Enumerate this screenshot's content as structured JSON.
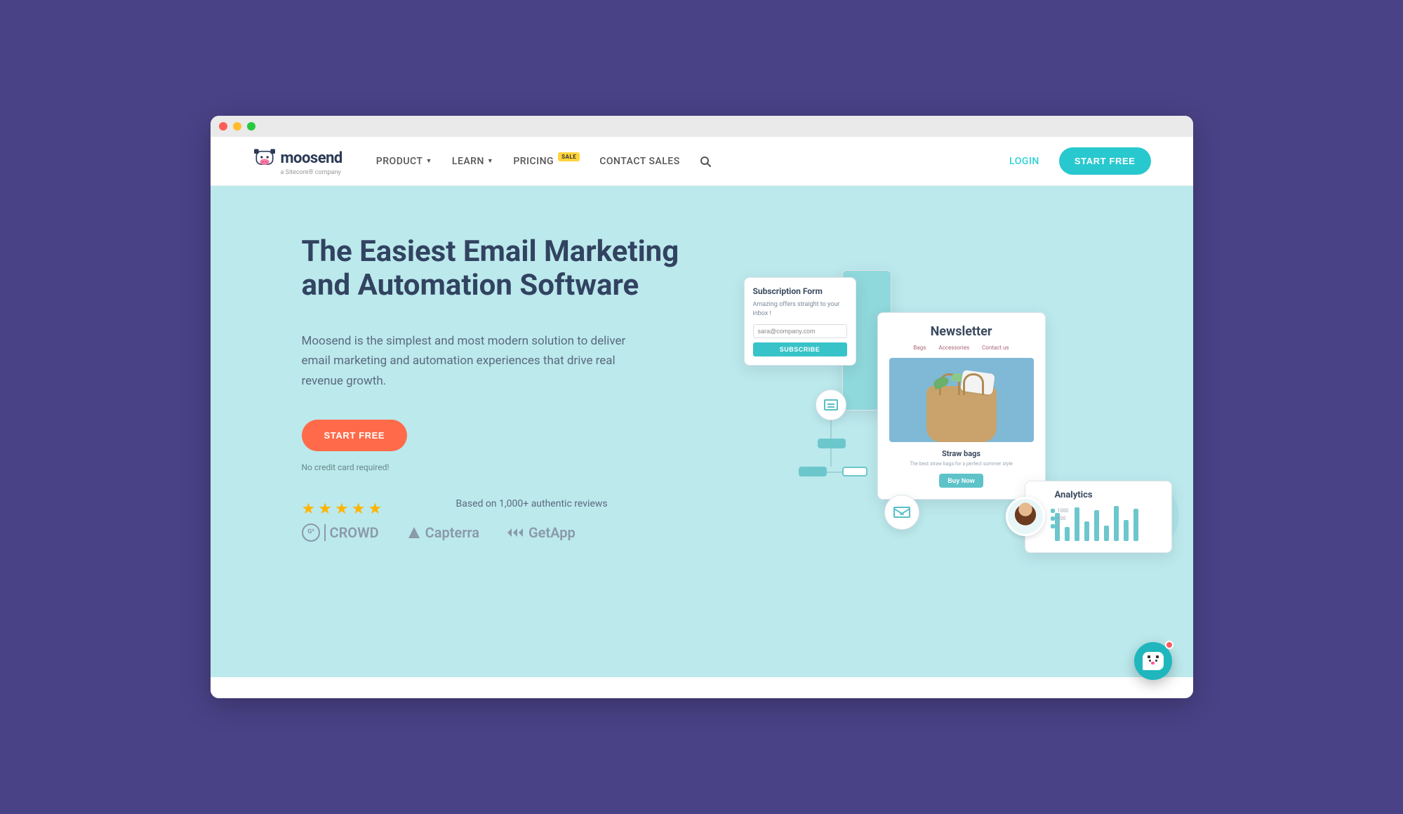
{
  "logo": {
    "name": "moosend",
    "tagline": "a Sitecore® company"
  },
  "nav": {
    "product": "PRODUCT",
    "learn": "LEARN",
    "pricing": "PRICING",
    "pricing_badge": "SALE",
    "contact": "CONTACT SALES"
  },
  "header": {
    "login": "LOGIN",
    "cta": "START FREE"
  },
  "hero": {
    "title": "The Easiest Email Marketing and Automation Software",
    "subtitle": "Moosend is the simplest and most modern solution to deliver email marketing and automation experiences that drive real revenue growth.",
    "cta": "START FREE",
    "note": "No credit card required!",
    "reviews_line": "Based on 1,000+ authentic reviews",
    "review_logos": {
      "g2": "CROWD",
      "capterra": "Capterra",
      "getapp": "GetApp"
    }
  },
  "sub_form": {
    "title": "Subscription Form",
    "desc": "Amazing offers straight to your inbox !",
    "value": "sara@company.com",
    "btn": "SUBSCRIBE"
  },
  "newsletter": {
    "title": "Newsletter",
    "tabs": {
      "a": "Bags",
      "b": "Accessories",
      "c": "Contact us"
    },
    "product_title": "Straw bags",
    "product_desc": "The best straw bags for a perfect summer style",
    "buy": "Buy Now"
  },
  "analytics": {
    "title": "Analytics",
    "legend": {
      "a": "1000",
      "b": "500",
      "c": "0"
    },
    "bars": [
      40,
      20,
      48,
      28,
      44,
      22,
      50,
      30,
      46
    ]
  }
}
